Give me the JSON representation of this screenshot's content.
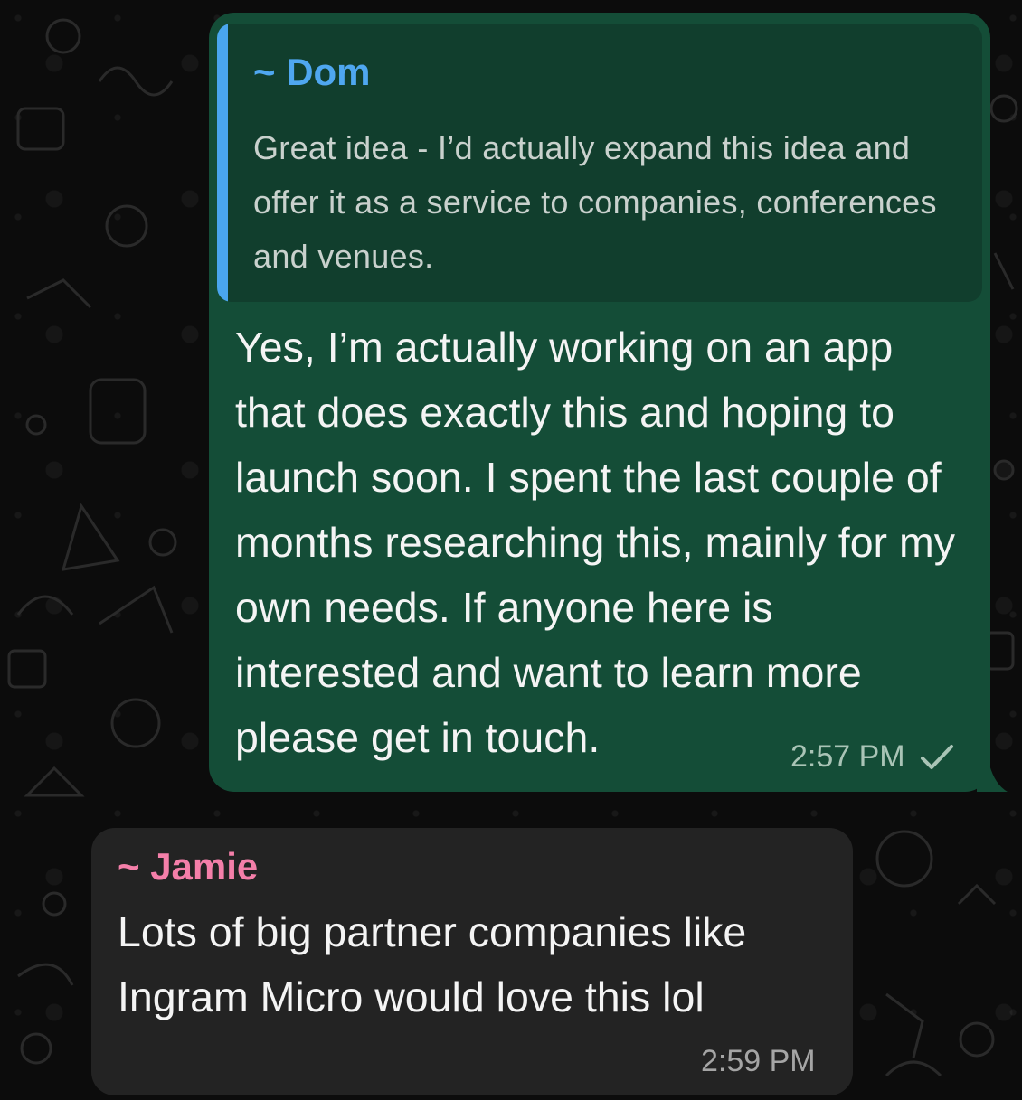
{
  "outgoing_message": {
    "quoted": {
      "author": "~ Dom",
      "text": "Great idea - I’d actually expand this idea and offer it as a service to companies, conferences and venues."
    },
    "text": "Yes, I’m actually working on an app that does exactly this and hoping to launch soon. I spent the last couple of months researching this, mainly for my own needs. If anyone here is interested and want to learn more please get in touch.",
    "time": "2:57 PM",
    "status_icon": "single-check-icon"
  },
  "incoming_message": {
    "sender": "~ Jamie",
    "text": "Lots of big partner companies like Ingram Micro would love this lol",
    "time": "2:59 PM"
  },
  "colors": {
    "outgoing_bubble": "#144d37",
    "incoming_bubble": "#232323",
    "quote_author": "#4fa7f0",
    "sender_name": "#f47fa9"
  }
}
